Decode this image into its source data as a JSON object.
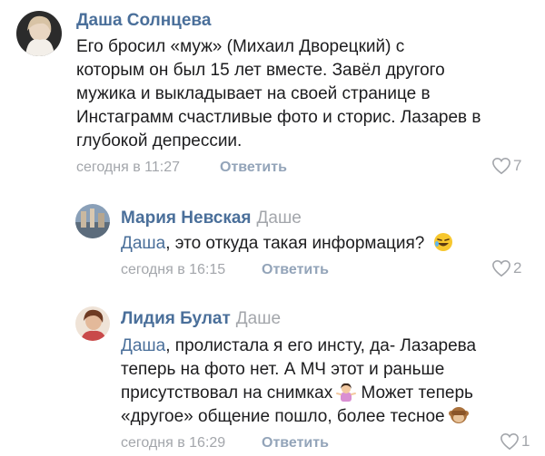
{
  "comments": [
    {
      "author": "Даша Солнцева",
      "reply_to": "",
      "text": "Его бросил «муж» (Михаил Дворецкий) с которым он был 15 лет вместе. Завёл другого мужика и выкладывает на своей странице в Инстаграмм счастливые фото и сторис. Лазарев в глубокой депрессии.",
      "text_lines": [
        "Его бросил «муж» (Михаил Дворецкий) с",
        "которым он был 15 лет вместе. Завёл другого",
        "мужика и выкладывает на своей странице в",
        "Инстаграмм счастливые фото и сторис. Лазарев в",
        "глубокой депрессии."
      ],
      "time": "сегодня в 11:27",
      "reply_label": "Ответить",
      "likes": "7"
    },
    {
      "author": "Мария Невская",
      "reply_to": "Даше",
      "mention": "Даша",
      "text": ", это откуда такая информация?",
      "time": "сегодня в 16:15",
      "reply_label": "Ответить",
      "likes": "2",
      "emoji": "rolling-laughing-emoji"
    },
    {
      "author": "Лидия Булат",
      "reply_to": "Даше",
      "mention": "Даша",
      "text_lines": [
        ", пролистала я его инсту, да- Лазарева",
        "теперь на фото нет. А МЧ этот и раньше",
        "присутствовал на снимках",
        " Может теперь",
        "«другое» общение пошло, более тесное"
      ],
      "time": "сегодня в 16:29",
      "reply_label": "Ответить",
      "likes": "1",
      "emojis": [
        "shrugging-woman-emoji",
        "see-no-evil-monkey-emoji"
      ]
    }
  ],
  "colors": {
    "author": "#4a6f9a",
    "meta": "#a3a6ab",
    "reply": "#93a4b9"
  }
}
